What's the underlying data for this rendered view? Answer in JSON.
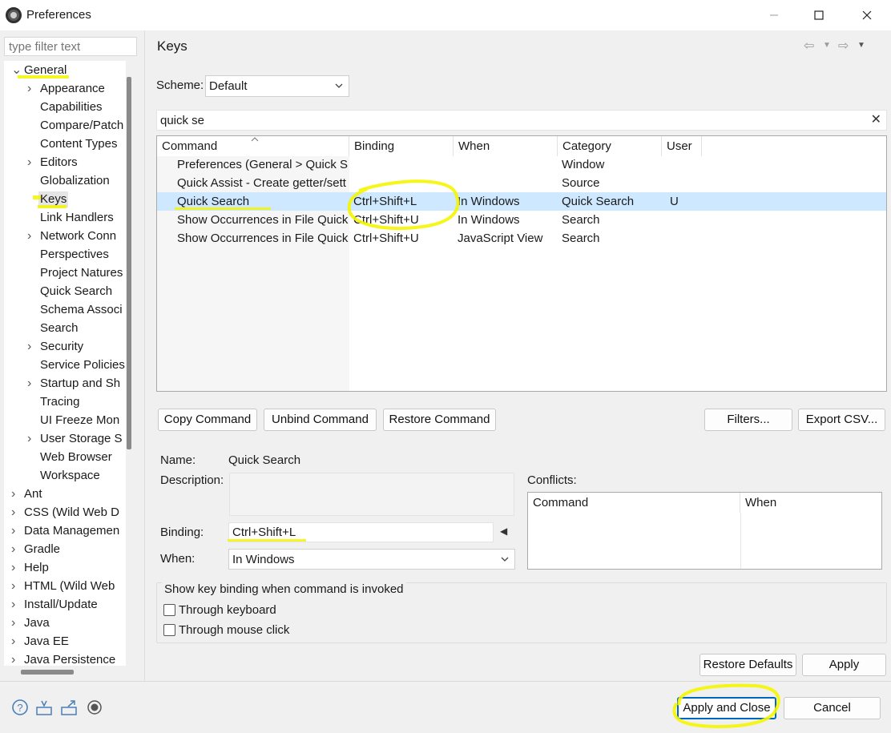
{
  "window": {
    "title": "Preferences"
  },
  "filter": {
    "placeholder": "type filter text"
  },
  "tree": {
    "items": [
      {
        "label": "General",
        "expanded": true
      },
      {
        "label": "Appearance",
        "expandable": true
      },
      {
        "label": "Capabilities"
      },
      {
        "label": "Compare/Patch"
      },
      {
        "label": "Content Types"
      },
      {
        "label": "Editors",
        "expandable": true
      },
      {
        "label": "Globalization"
      },
      {
        "label": "Keys",
        "selected": true
      },
      {
        "label": "Link Handlers"
      },
      {
        "label": "Network Conn",
        "expandable": true
      },
      {
        "label": "Perspectives"
      },
      {
        "label": "Project Natures"
      },
      {
        "label": "Quick Search"
      },
      {
        "label": "Schema Associ"
      },
      {
        "label": "Search"
      },
      {
        "label": "Security",
        "expandable": true
      },
      {
        "label": "Service Policies"
      },
      {
        "label": "Startup and Sh",
        "expandable": true
      },
      {
        "label": "Tracing"
      },
      {
        "label": "UI Freeze Mon"
      },
      {
        "label": "User Storage S",
        "expandable": true
      },
      {
        "label": "Web Browser"
      },
      {
        "label": "Workspace"
      },
      {
        "label": "Ant",
        "expandable": true
      },
      {
        "label": "CSS (Wild Web D",
        "expandable": true
      },
      {
        "label": "Data Managemen",
        "expandable": true
      },
      {
        "label": "Gradle",
        "expandable": true
      },
      {
        "label": "Help",
        "expandable": true
      },
      {
        "label": "HTML (Wild Web",
        "expandable": true
      },
      {
        "label": "Install/Update",
        "expandable": true
      },
      {
        "label": "Java",
        "expandable": true
      },
      {
        "label": "Java EE",
        "expandable": true
      },
      {
        "label": "Java Persistence",
        "expandable": true
      }
    ]
  },
  "page": {
    "title": "Keys"
  },
  "scheme": {
    "label": "Scheme:",
    "value": "Default"
  },
  "search": {
    "value": "quick se"
  },
  "table": {
    "columns": [
      "Command",
      "Binding",
      "When",
      "Category",
      "User"
    ],
    "rows": [
      {
        "command": "Preferences (General > Quick S",
        "binding": "",
        "when": "",
        "category": "Window",
        "user": ""
      },
      {
        "command": "Quick Assist - Create getter/sett",
        "binding": "",
        "when": "",
        "category": "Source",
        "user": ""
      },
      {
        "command": "Quick Search",
        "binding": "Ctrl+Shift+L",
        "when": "In Windows",
        "category": "Quick Search",
        "user": "U",
        "selected": true
      },
      {
        "command": "Show Occurrences in File Quick",
        "binding": "Ctrl+Shift+U",
        "when": "In Windows",
        "category": "Search",
        "user": ""
      },
      {
        "command": "Show Occurrences in File Quick",
        "binding": "Ctrl+Shift+U",
        "when": "JavaScript View",
        "category": "Search",
        "user": ""
      }
    ]
  },
  "buttons": {
    "copy": "Copy Command",
    "unbind": "Unbind Command",
    "restore": "Restore Command",
    "filters": "Filters...",
    "export": "Export CSV...",
    "restore_defaults": "Restore Defaults",
    "apply": "Apply",
    "apply_close": "Apply and Close",
    "cancel": "Cancel"
  },
  "details": {
    "name_label": "Name:",
    "name_value": "Quick Search",
    "description_label": "Description:",
    "binding_label": "Binding:",
    "binding_value": "Ctrl+Shift+L",
    "when_label": "When:",
    "when_value": "In Windows",
    "conflicts_label": "Conflicts:",
    "conflicts_columns": [
      "Command",
      "When"
    ]
  },
  "show_binding": {
    "legend": "Show key binding when command is invoked",
    "keyboard": "Through keyboard",
    "keyboard_checked": false,
    "mouse": "Through mouse click",
    "mouse_checked": false
  },
  "footer_icons": [
    "help-icon",
    "import-icon",
    "export-icon",
    "record-icon"
  ],
  "highlight_color": "#f5f500"
}
